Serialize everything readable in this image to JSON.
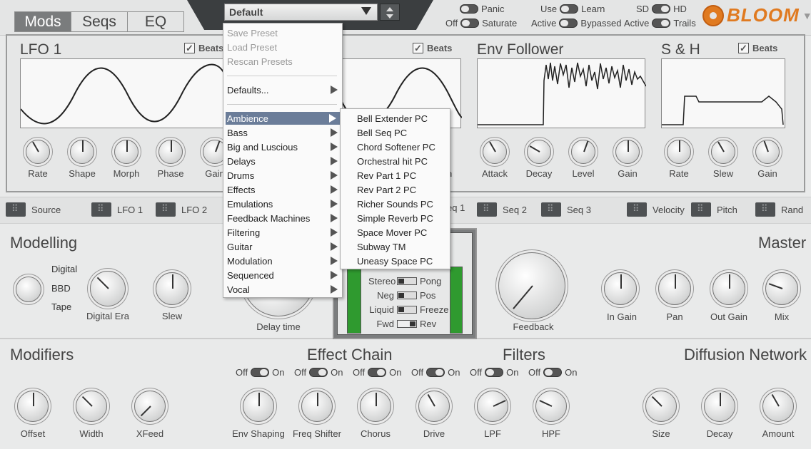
{
  "header": {
    "tabs": [
      "Mods",
      "Seqs",
      "EQ"
    ],
    "preset_value": "Default",
    "toggles": [
      {
        "left": "",
        "right": "Panic"
      },
      {
        "left": "Off",
        "right": "Saturate"
      },
      {
        "left": "Use",
        "right": "Learn"
      },
      {
        "left": "Active",
        "right": "Bypassed"
      },
      {
        "left": "SD",
        "right": "HD"
      },
      {
        "left": "Active",
        "right": "Trails"
      }
    ],
    "logo_text": "BLOOM",
    "accent_color": "#e07a20"
  },
  "mod_panels": {
    "lfo1": {
      "title": "LFO 1",
      "beats": "Beats",
      "knobs": [
        "Rate",
        "Shape",
        "Morph",
        "Phase",
        "Gain"
      ]
    },
    "lfo2": {
      "beats": "Beats",
      "knob_tail": "n"
    },
    "env": {
      "title": "Env Follower",
      "knobs": [
        "Attack",
        "Decay",
        "Level",
        "Gain"
      ]
    },
    "sh": {
      "title": "S & H",
      "beats": "Beats",
      "knobs": [
        "Rate",
        "Slew",
        "Gain"
      ]
    }
  },
  "sources": [
    "Source",
    "LFO 1",
    "LFO 2",
    "eq 1",
    "Seq 2",
    "Seq 3",
    "Velocity",
    "Pitch",
    "Rand"
  ],
  "modelling": {
    "title": "Modelling",
    "modes": [
      "Digital",
      "BBD",
      "Tape"
    ],
    "knobs": [
      "Digital Era",
      "Slew"
    ],
    "delay_label": "Delay time"
  },
  "meter": {
    "rows": [
      {
        "left": "Stereo",
        "right": "Pong"
      },
      {
        "left": "Neg",
        "right": "Pos"
      },
      {
        "left": "Liquid",
        "right": "Freeze"
      },
      {
        "left": "Fwd",
        "right": "Rev"
      }
    ],
    "level_left": 0.65,
    "level_right": 0.65
  },
  "feedback_label": "Feedback",
  "master": {
    "title": "Master",
    "knobs": [
      "In Gain",
      "Pan",
      "Out Gain",
      "Mix"
    ]
  },
  "modifiers": {
    "title": "Modifiers",
    "knobs": [
      "Offset",
      "Width",
      "XFeed"
    ]
  },
  "effect_chain": {
    "title": "Effect Chain",
    "knobs": [
      "Env Shaping",
      "Freq Shifter",
      "Chorus",
      "Drive"
    ],
    "off": "Off",
    "on": "On"
  },
  "filters": {
    "title": "Filters",
    "knobs": [
      "LPF",
      "HPF"
    ]
  },
  "diffusion": {
    "title": "Diffusion Network",
    "knobs": [
      "Size",
      "Decay",
      "Amount"
    ]
  },
  "preset_menu": {
    "actions": [
      "Save Preset",
      "Load Preset",
      "Rescan Presets"
    ],
    "defaults": "Defaults...",
    "categories": [
      "Ambience",
      "Bass",
      "Big and Luscious",
      "Delays",
      "Drums",
      "Effects",
      "Emulations",
      "Feedback Machines",
      "Filtering",
      "Guitar",
      "Modulation",
      "Sequenced",
      "Vocal"
    ],
    "selected_category": "Ambience"
  },
  "submenu": {
    "items": [
      "Bell Extender PC",
      "Bell Seq PC",
      "Chord Softener PC",
      "Orchestral hit PC",
      "Rev Part 1 PC",
      "Rev Part 2 PC",
      "Richer Sounds PC",
      "Simple Reverb PC",
      "Space Mover PC",
      "Subway TM",
      "Uneasy Space PC"
    ]
  }
}
